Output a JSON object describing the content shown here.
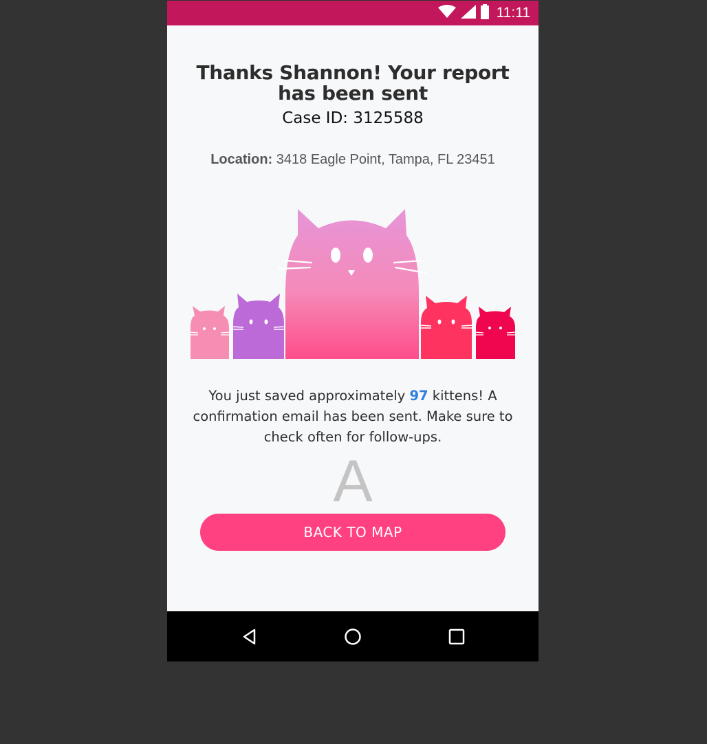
{
  "status_bar": {
    "time": "11:11",
    "icons": [
      "wifi-icon",
      "signal-icon",
      "battery-icon"
    ]
  },
  "confirmation": {
    "title": "Thanks Shannon! Your report has been sent",
    "case_id": "Case ID: 3125588",
    "location_label": "Location:",
    "location_value": "3418 Eagle Point, Tampa, FL 23451"
  },
  "message": {
    "before": "You just saved approximately ",
    "count": "97",
    "after": " kittens! A confirmation email has been sent. Make sure to check often for follow-ups."
  },
  "placeholder_glyph": "A",
  "actions": {
    "back_label": "BACK TO MAP"
  },
  "nav": {
    "icons": [
      "back-icon",
      "home-icon",
      "recents-icon"
    ]
  },
  "colors": {
    "status_bar": "#c2185b",
    "accent": "#ff4081",
    "highlight_number": "#2f7fe0",
    "background": "#f7f8fa"
  }
}
